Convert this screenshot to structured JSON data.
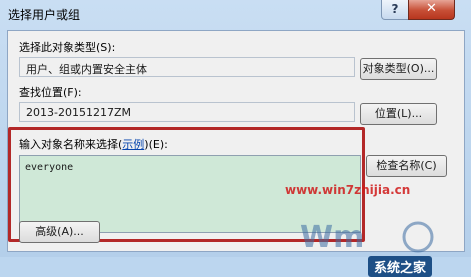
{
  "window": {
    "title": "选择用户或组",
    "help_glyph": "?",
    "close_glyph": "✕"
  },
  "object_type": {
    "label": "选择此对象类型(S):",
    "value": "用户、组或内置安全主体",
    "button": "对象类型(O)..."
  },
  "location": {
    "label": "查找位置(F):",
    "value": "2013-20151217ZM",
    "button": "位置(L)..."
  },
  "names": {
    "label_prefix": "输入对象名称来选择(",
    "label_link": "示例",
    "label_suffix": ")(E):",
    "value": "everyone",
    "check_button": "检查名称(C)"
  },
  "advanced_button": "高级(A)...",
  "watermark": {
    "site": "www.win7zhijia.cn",
    "brand": "系统之家"
  }
}
